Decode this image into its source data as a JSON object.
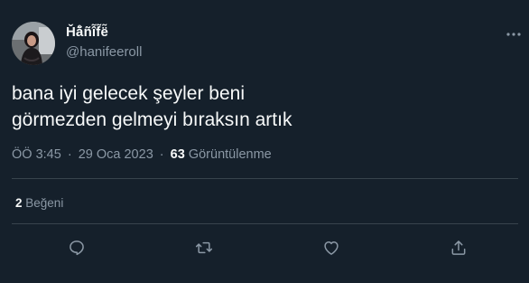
{
  "author": {
    "display_name": "Ȟå̃ñî̃f̃ë̃",
    "handle": "@hanifeeroll"
  },
  "tweet": {
    "lines": [
      "bana iyi gelecek şeyler beni",
      "görmezden gelmeyi bıraksın artık"
    ]
  },
  "meta": {
    "time": "ÖÖ 3:45",
    "separator": "·",
    "date": "29 Oca 2023",
    "views_count": "63",
    "views_label": "Görüntülenme"
  },
  "engagement": {
    "likes_count": "2",
    "likes_label": "Beğeni"
  },
  "actions": [
    "reply-icon",
    "retweet-icon",
    "like-icon",
    "share-icon"
  ],
  "colors": {
    "background": "#15202b",
    "text": "#f7f9f9",
    "secondary": "#8b98a5",
    "divider": "#38444d"
  }
}
